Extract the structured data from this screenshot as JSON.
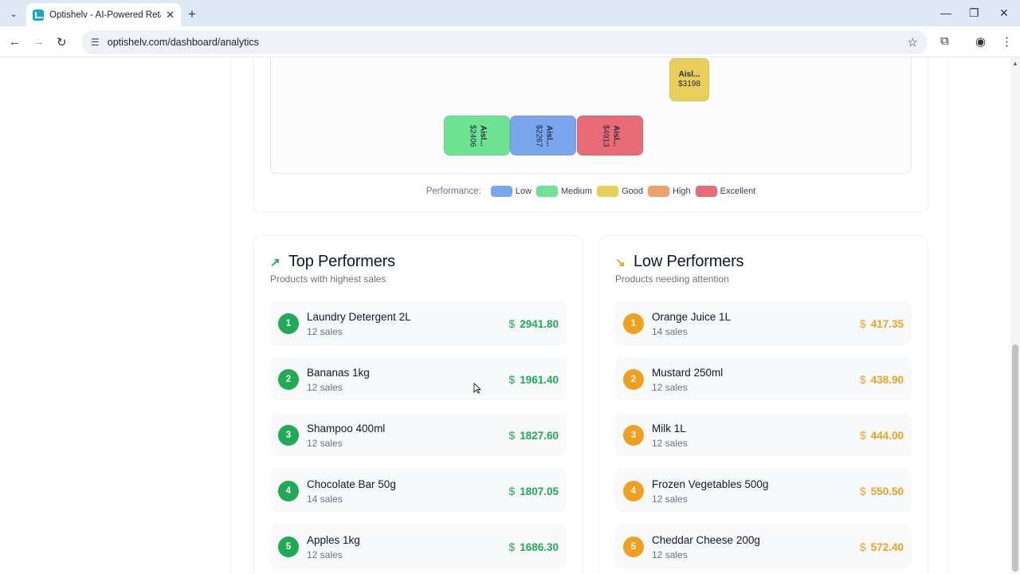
{
  "browser": {
    "tab_title": "Optishelv - AI-Powered Retail S",
    "url": "optishelv.com/dashboard/analytics"
  },
  "heatmap": {
    "cells": [
      {
        "label": "Aisl...",
        "value": "$3198",
        "color": "#e8cf5a"
      },
      {
        "label": "Aisl...",
        "value": "$2406",
        "color": "#6ee394"
      },
      {
        "label": "Aisl...",
        "value": "$2267",
        "color": "#7aa6f0"
      },
      {
        "label": "Aisl...",
        "value": "$4913",
        "color": "#ea6b78"
      }
    ],
    "legend_label": "Performance:",
    "legend": [
      {
        "name": "Low",
        "color": "#7aa6f0"
      },
      {
        "name": "Medium",
        "color": "#6ee394"
      },
      {
        "name": "Good",
        "color": "#e8cf5a"
      },
      {
        "name": "High",
        "color": "#f0a06a"
      },
      {
        "name": "Excellent",
        "color": "#ea6b78"
      }
    ]
  },
  "top": {
    "title": "Top Performers",
    "subtitle": "Products with highest sales",
    "icon": "trending-up-icon",
    "accent": "#1faa55",
    "items": [
      {
        "rank": "1",
        "name": "Laundry Detergent 2L",
        "sales": "12 sales",
        "amount": "2941.80"
      },
      {
        "rank": "2",
        "name": "Bananas 1kg",
        "sales": "12 sales",
        "amount": "1961.40"
      },
      {
        "rank": "3",
        "name": "Shampoo 400ml",
        "sales": "12 sales",
        "amount": "1827.60"
      },
      {
        "rank": "4",
        "name": "Chocolate Bar 50g",
        "sales": "14 sales",
        "amount": "1807.05"
      },
      {
        "rank": "5",
        "name": "Apples 1kg",
        "sales": "12 sales",
        "amount": "1686.30"
      }
    ]
  },
  "low": {
    "title": "Low Performers",
    "subtitle": "Products needing attention",
    "icon": "trending-down-icon",
    "accent": "#f0a01f",
    "items": [
      {
        "rank": "1",
        "name": "Orange Juice 1L",
        "sales": "14 sales",
        "amount": "417.35"
      },
      {
        "rank": "2",
        "name": "Mustard 250ml",
        "sales": "12 sales",
        "amount": "438.90"
      },
      {
        "rank": "3",
        "name": "Milk 1L",
        "sales": "12 sales",
        "amount": "444.00"
      },
      {
        "rank": "4",
        "name": "Frozen Vegetables 500g",
        "sales": "12 sales",
        "amount": "550.50"
      },
      {
        "rank": "5",
        "name": "Cheddar Cheese 200g",
        "sales": "12 sales",
        "amount": "572.40"
      }
    ]
  },
  "currency_symbol": "$"
}
